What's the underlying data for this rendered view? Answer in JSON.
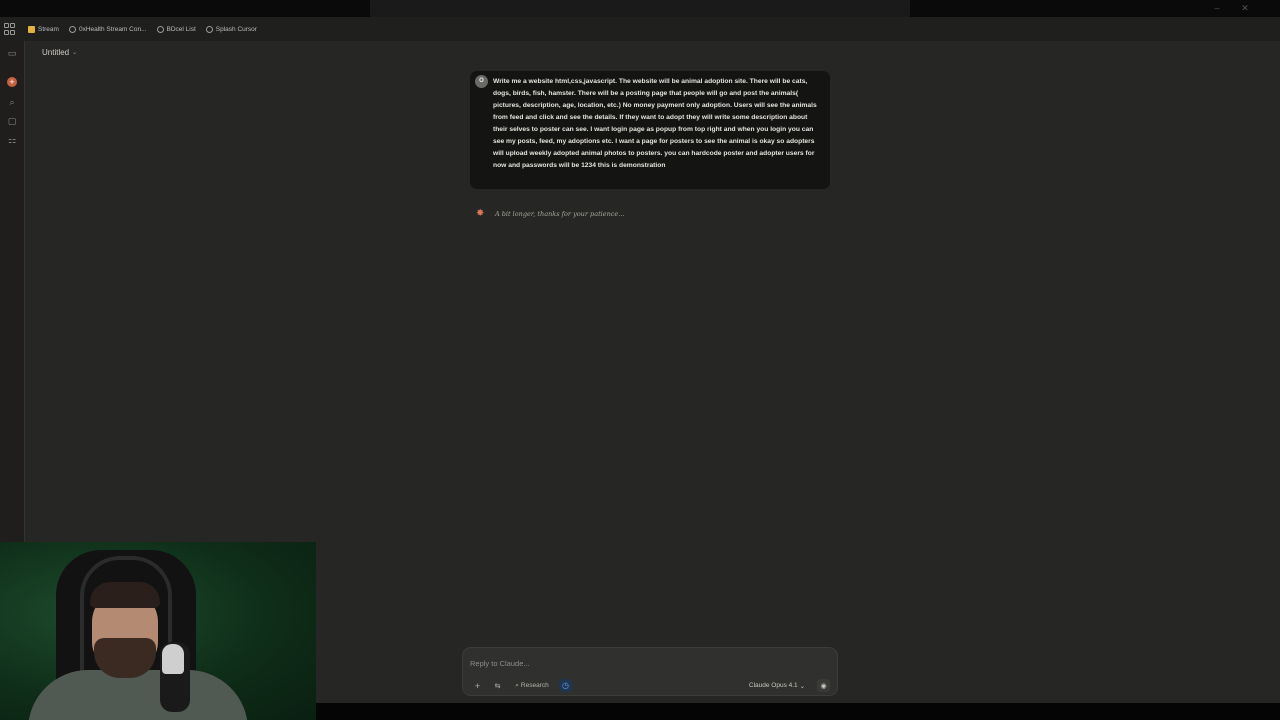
{
  "bookmarks": {
    "items": [
      {
        "label": "Stream",
        "icon": "folder-icon"
      },
      {
        "label": "0xHealth Stream Con...",
        "icon": "globe-icon"
      },
      {
        "label": "BDcel List",
        "icon": "globe-icon"
      },
      {
        "label": "Splash Cursor",
        "icon": "globe-icon"
      }
    ]
  },
  "conversation": {
    "title": "Untitled",
    "user_avatar": "O",
    "user_message": "Write me a website html,css,javascript. The website will be animal adoption site. There will be cats, dogs, birds, fish, hamster. There will be a posting page that people will go and post the animals( pictures, description, age, location, etc.) No money payment only adoption. Users will see the animals from feed and click and see the details. If they want to adopt they will write some description about their selves to poster can see. I want login page as popup from top right and when you login you can see my posts, feed, my adoptions etc. I want a page for posters to see the animal is okay so adopters will upload weekly adopted animal photos to posters. you can hardcode poster and adopter users for now and passwords will be 1234 this is demonstration",
    "thinking_text": "A bit longer, thanks for your patience..."
  },
  "composer": {
    "placeholder": "Reply to Claude...",
    "research_label": "Research",
    "model_label": "Claude Opus 4.1"
  },
  "colors": {
    "accent": "#d97757",
    "background": "#262624",
    "message_bg": "#141413"
  }
}
